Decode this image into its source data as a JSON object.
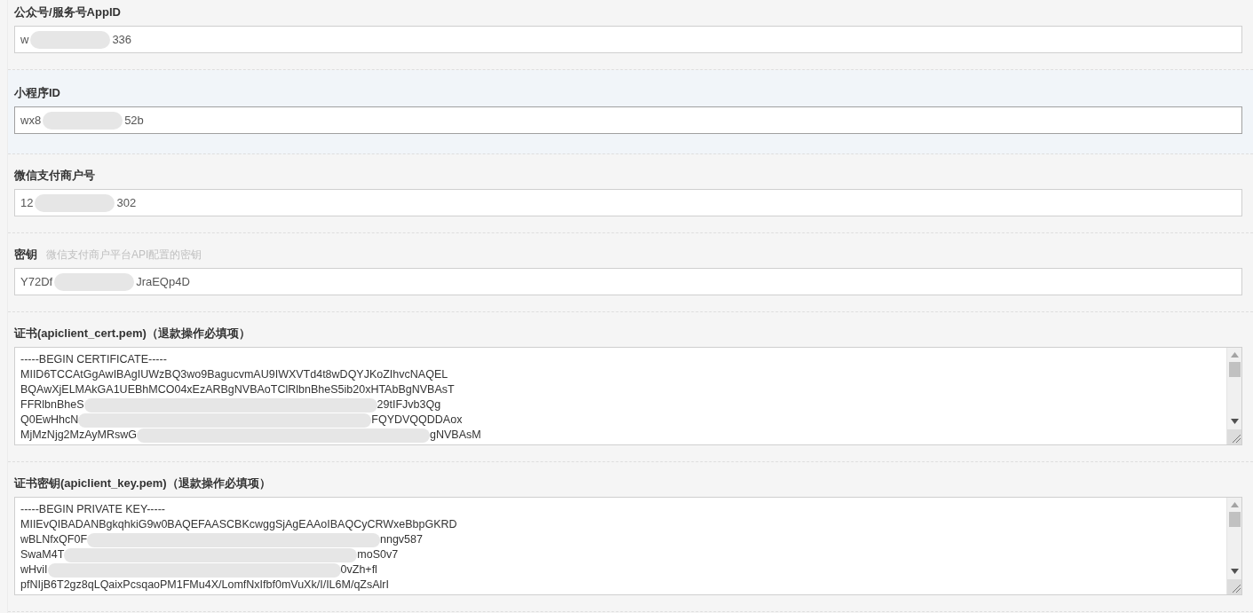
{
  "fields": [
    {
      "kind": "input",
      "label": "公众号/服务号AppID",
      "highlighted": false,
      "value": {
        "before": "w",
        "after": "336"
      }
    },
    {
      "kind": "input",
      "label": "小程序ID",
      "highlighted": true,
      "value": {
        "before": "wx8",
        "after": "52b"
      }
    },
    {
      "kind": "input",
      "label": "微信支付商户号",
      "highlighted": false,
      "value": {
        "before": "12",
        "after": "302"
      }
    },
    {
      "kind": "input",
      "label": "密钥",
      "hint": "微信支付商户平台API配置的密钥",
      "highlighted": false,
      "value": {
        "before": "Y72Df",
        "after": "JraEQp4D"
      }
    },
    {
      "kind": "textarea",
      "label": "证书(apiclient_cert.pem)（退款操作必填项）",
      "highlighted": false,
      "lines": [
        {
          "before": "-----BEGIN CERTIFICATE-----"
        },
        {
          "before": "MIID6TCCAtGgAwIBAgIUWzBQ3wo9BagucvmAU9IWXVTd4t8wDQYJKoZIhvcNAQEL"
        },
        {
          "before": "BQAwXjELMAkGA1UEBhMCO04xEzARBgNVBAoTClRlbnBheS5ib20xHTAbBgNVBAsT"
        },
        {
          "before": "FFRlbnBheS",
          "after": "29tIFJvb3Qg"
        },
        {
          "before": "Q0EwHhcN",
          "after": "FQYDVQQDDAox"
        },
        {
          "before": "MjMzNjg2MzAyMRswG",
          "after": "gNVBAsM"
        }
      ]
    },
    {
      "kind": "textarea",
      "label": "证书密钥(apiclient_key.pem)（退款操作必填项）",
      "highlighted": false,
      "lines": [
        {
          "before": "-----BEGIN PRIVATE KEY-----"
        },
        {
          "before": "MIIEvQIBADANBgkqhkiG9w0BAQEFAASCBKcwggSjAgEAAoIBAQCyCRWxeBbpGKRD"
        },
        {
          "before": "wBLNfxQF0F",
          "after": "nngv587"
        },
        {
          "before": "SwaM4T",
          "after": "moS0v7"
        },
        {
          "before": "wHviI",
          "after": "0vZh+fl"
        },
        {
          "before": "pfNIjB6T2gz8qLQaixPcsqaoPM1FMu4X/LomfNxIfbf0mVuXk/I/IL6M/qZsAlrI"
        }
      ]
    }
  ]
}
